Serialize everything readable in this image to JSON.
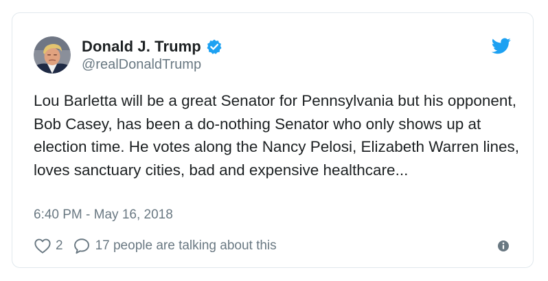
{
  "tweet": {
    "author": {
      "display_name": "Donald J. Trump",
      "handle": "@realDonaldTrump",
      "verified": true
    },
    "text": "Lou Barletta will be a great Senator for Pennsylvania but his opponent, Bob Casey, has been a do-nothing Senator who only shows up at election time. He votes along the Nancy Pelosi, Elizabeth Warren lines, loves sanctuary cities, bad and expensive healthcare...",
    "timestamp": "6:40 PM - May 16, 2018",
    "likes": "2",
    "conversation": "17 people are talking about this"
  },
  "icons": {
    "avatar": "avatar-photo",
    "verified": "verified-badge-icon",
    "brand": "twitter-bird-icon",
    "like": "heart-icon",
    "reply": "reply-bubble-icon",
    "info": "info-icon"
  },
  "colors": {
    "brand_blue": "#1da1f2",
    "text": "#1c2022",
    "muted": "#697882",
    "border": "#e1e8ed"
  }
}
